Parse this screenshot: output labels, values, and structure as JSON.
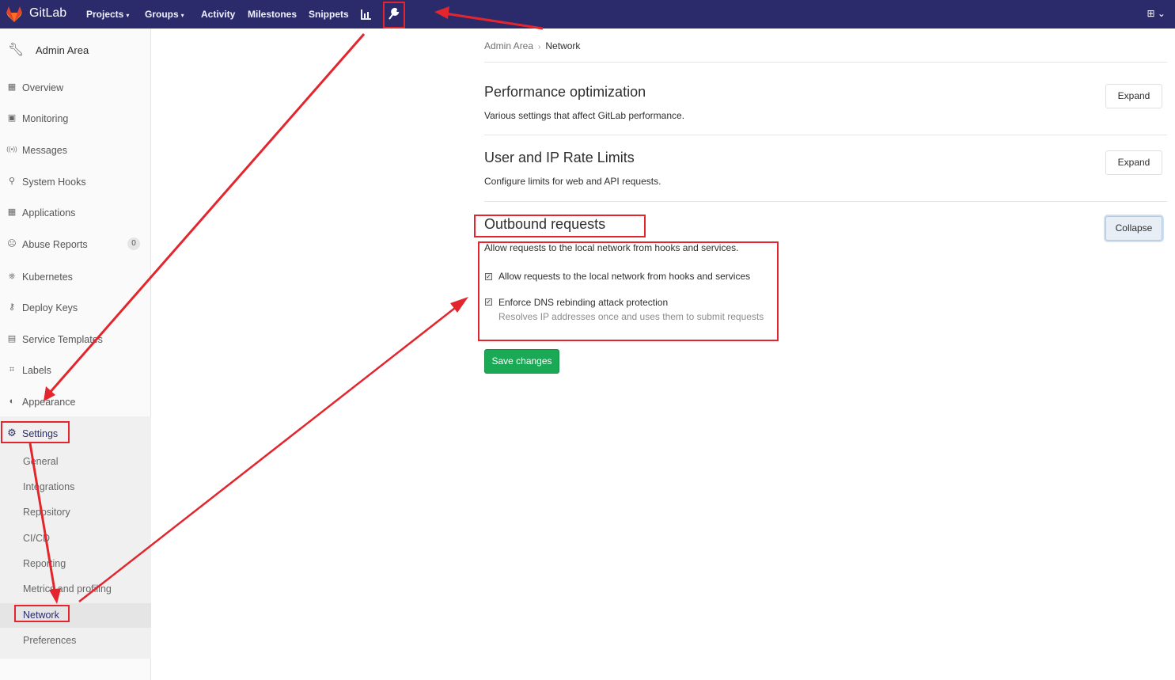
{
  "navbar": {
    "brand": "GitLab",
    "items": [
      {
        "label": "Projects",
        "caret": "⌄"
      },
      {
        "label": "Groups",
        "caret": "⌄"
      },
      {
        "label": "Activity"
      },
      {
        "label": "Milestones"
      },
      {
        "label": "Snippets"
      }
    ],
    "chart_icon": "chart-icon",
    "admin_icon": "wrench-icon",
    "plus_label": "⊞ ⌄"
  },
  "sidebar": {
    "title": "Admin Area",
    "items": [
      {
        "label": "Overview",
        "icon": "▦"
      },
      {
        "label": "Monitoring",
        "icon": "▣"
      },
      {
        "label": "Messages",
        "icon": "((•))"
      },
      {
        "label": "System Hooks",
        "icon": "⚲"
      },
      {
        "label": "Applications",
        "icon": "▦"
      },
      {
        "label": "Abuse Reports",
        "icon": "☹",
        "badge": "0"
      },
      {
        "label": "Kubernetes",
        "icon": "⎈"
      },
      {
        "label": "Deploy Keys",
        "icon": "⚷"
      },
      {
        "label": "Service Templates",
        "icon": "▤"
      },
      {
        "label": "Labels",
        "icon": "⌗"
      },
      {
        "label": "Appearance",
        "icon": "◐"
      },
      {
        "label": "Settings",
        "icon": "⚙"
      }
    ],
    "settings_sub": [
      "General",
      "Integrations",
      "Repository",
      "CI/CD",
      "Reporting",
      "Metrics and profiling",
      "Network",
      "Preferences"
    ]
  },
  "breadcrumb": {
    "parent": "Admin Area",
    "sep": "›",
    "current": "Network"
  },
  "sections": [
    {
      "title": "Performance optimization",
      "desc": "Various settings that affect GitLab performance.",
      "button": "Expand"
    },
    {
      "title": "User and IP Rate Limits",
      "desc": "Configure limits for web and API requests.",
      "button": "Expand"
    },
    {
      "title": "Outbound requests",
      "desc": "Allow requests to the local network from hooks and services.",
      "button": "Collapse"
    }
  ],
  "checkboxes": [
    {
      "label": "Allow requests to the local network from hooks and services",
      "checked": true
    },
    {
      "label": "Enforce DNS rebinding attack protection",
      "help": "Resolves IP addresses once and uses them to submit requests",
      "checked": true
    }
  ],
  "save_label": "Save changes",
  "colors": {
    "navbar": "#2b2b6b",
    "save": "#1aaa55",
    "annotation": "#e3262d"
  }
}
